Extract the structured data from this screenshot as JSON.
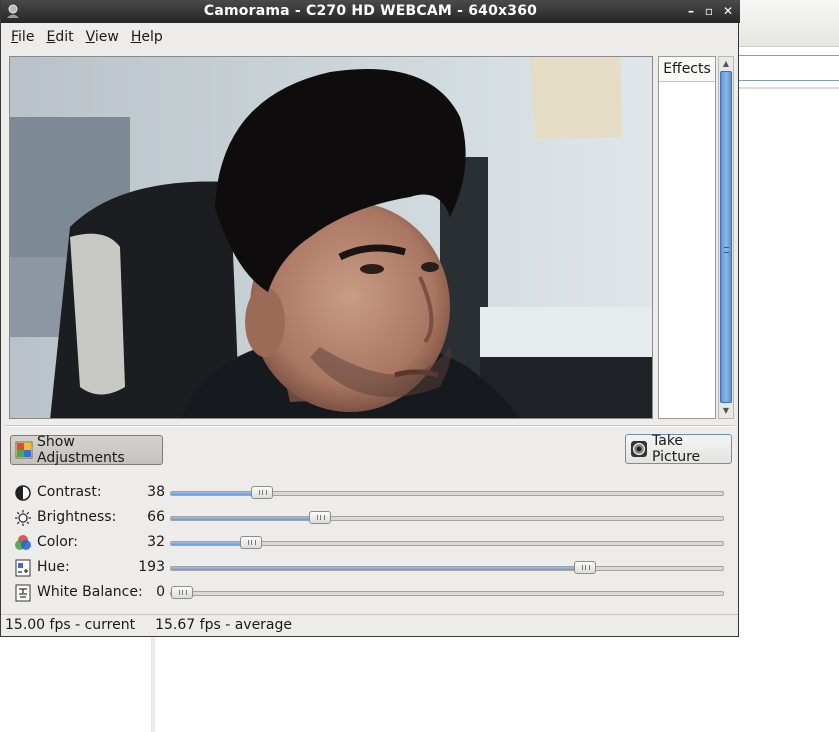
{
  "window": {
    "title": "Camorama - C270 HD WEBCAM - 640x360",
    "controls": {
      "minimize": "–",
      "maximize": "▫",
      "close": "✕"
    }
  },
  "menu": [
    {
      "label": "File",
      "mnemonic": "F",
      "rest": "ile"
    },
    {
      "label": "Edit",
      "mnemonic": "E",
      "rest": "dit"
    },
    {
      "label": "View",
      "mnemonic": "V",
      "rest": "iew"
    },
    {
      "label": "Help",
      "mnemonic": "H",
      "rest": "elp"
    }
  ],
  "preview": {
    "description_icon": "webcam-preview"
  },
  "effects": {
    "header": "Effects"
  },
  "buttons": {
    "show_adjustments": "Show Adjustments",
    "take_picture": "Take Picture"
  },
  "adjustments": [
    {
      "icon": "contrast-icon",
      "label": "Contrast:",
      "value": "38",
      "fraction": 0.15
    },
    {
      "icon": "brightness-icon",
      "label": "Brightness:",
      "value": "66",
      "fraction": 0.26
    },
    {
      "icon": "color-icon",
      "label": "Color:",
      "value": "32",
      "fraction": 0.13
    },
    {
      "icon": "hue-icon",
      "label": "Hue:",
      "value": "193",
      "fraction": 0.76
    },
    {
      "icon": "white-balance-icon",
      "label": "White Balance:",
      "value": "0",
      "fraction": 0.0
    }
  ],
  "status": {
    "current": "15.00 fps - current",
    "average": "15.67 fps - average"
  },
  "colors": {
    "titlebar": "#2e2e2e",
    "accent": "#6a9bd6",
    "window_bg": "#edeceb"
  }
}
